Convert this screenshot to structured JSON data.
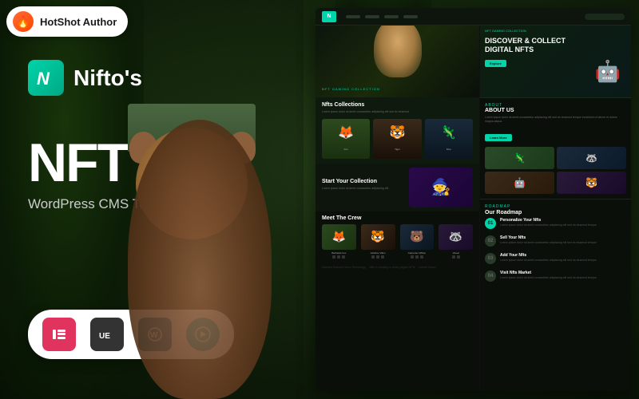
{
  "badge": {
    "icon": "🔥",
    "text": "HotShot Author"
  },
  "logo": {
    "letter": "N",
    "name": "Nifto's"
  },
  "main": {
    "title": "NFT",
    "subtitle": "WordPress CMS Template"
  },
  "tools": [
    {
      "name": "Elementor",
      "class": "tool-elementor",
      "icon": "E"
    },
    {
      "name": "Unyson",
      "class": "tool-ue",
      "icon": "UE"
    },
    {
      "name": "WordPress",
      "class": "tool-wp",
      "icon": "W"
    },
    {
      "name": "Revolution Slider",
      "class": "tool-rev",
      "icon": "R"
    }
  ],
  "website": {
    "hero_tag": "NFT Gaming Collection",
    "hero_heading": "DISCOVER & COLLECT\nDIGITAL NFTS",
    "hero_btn": "Explore",
    "collections_title": "Nfts Collections",
    "collections_desc": "Lorem ipsum dolor sit amet consectetur adipiscing elit sed do eiusmod",
    "about_title": "ABOUT US",
    "about_desc": "Lorem ipsum dolor sit amet consectetur adipiscing elit sed do eiusmod tempor incididunt ut labore et dolore magna aliqua.",
    "about_btn": "Learn More",
    "start_title": "Start Your Collection",
    "start_desc": "Lorem ipsum dolor sit amet consectetur adipiscing elit",
    "roadmap_title": "Our Roadmap",
    "crew_title": "Meet The Crew",
    "roadmap_items": [
      {
        "num": "01",
        "heading": "Personalize Your Nfts",
        "desc": "Lorem ipsum dolor sit amet consectetur adipiscing elit sed do eiusmod tempor"
      },
      {
        "num": "02",
        "heading": "Sell Your Nfts",
        "desc": "Lorem ipsum dolor sit amet consectetur adipiscing elit sed do eiusmod tempor"
      },
      {
        "num": "03",
        "heading": "Add Your Nfts",
        "desc": "Lorem ipsum dolor sit amet consectetur adipiscing elit sed do eiusmod tempor"
      },
      {
        "num": "04",
        "heading": "Visit Nfts Market",
        "desc": "Lorem ipsum dolor sit amet consectetur adipiscing elit sed do eiusmod tempor"
      }
    ],
    "crew_members": [
      {
        "name": "Barbaras Fox",
        "color": "#2a4a1e"
      },
      {
        "name": "Jackline Villon",
        "color": "#3a2a1a"
      },
      {
        "name": "Carpenter Wilton",
        "color": "#1a2a3a"
      },
      {
        "name": "Visual",
        "color": "#2a1a3a"
      }
    ]
  },
  "colors": {
    "accent": "#00d4aa",
    "bg_dark": "#0a0f0a",
    "bg_panel": "#0d150d",
    "text_light": "#ffffff",
    "text_muted": "#cccccc"
  }
}
